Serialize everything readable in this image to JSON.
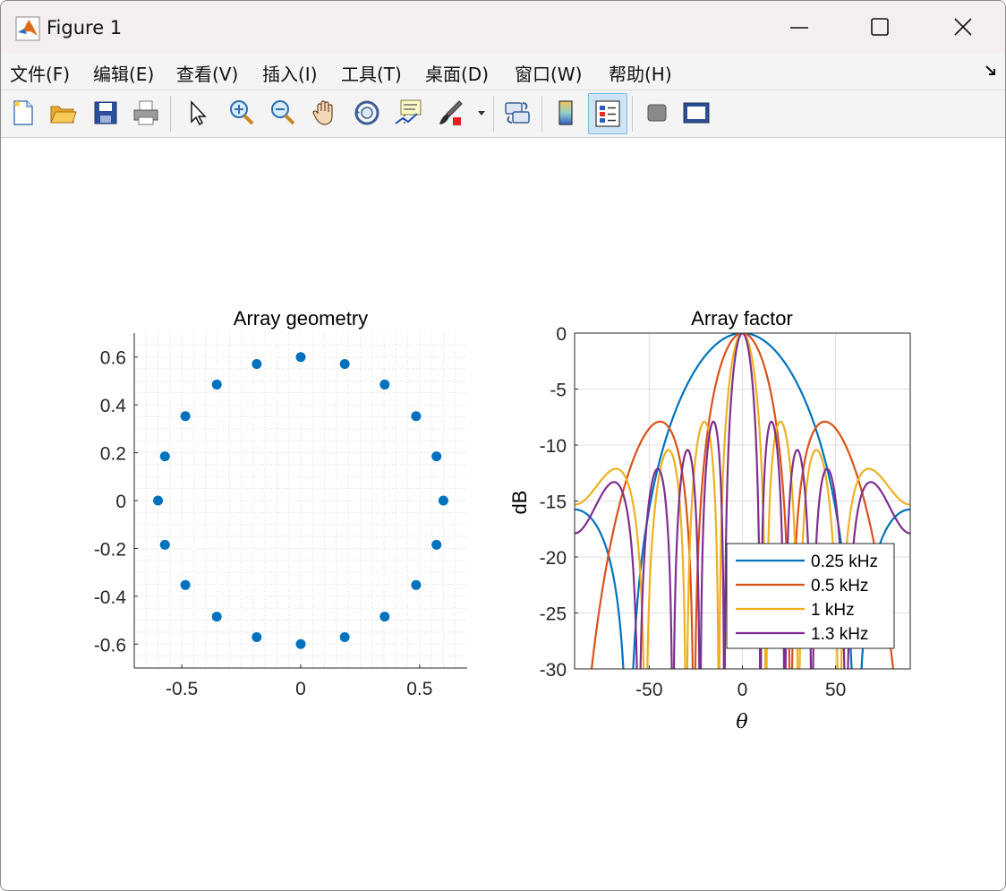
{
  "window": {
    "title": "Figure 1"
  },
  "menu": {
    "items": [
      {
        "label": "文件(F)"
      },
      {
        "label": "编辑(E)"
      },
      {
        "label": "查看(V)"
      },
      {
        "label": "插入(I)"
      },
      {
        "label": "工具(T)"
      },
      {
        "label": "桌面(D)"
      },
      {
        "label": "窗口(W)"
      },
      {
        "label": "帮助(H)"
      }
    ]
  },
  "toolbar": {
    "icons": [
      "new-figure-icon",
      "open-file-icon",
      "save-icon",
      "print-icon",
      "select-arrow-icon",
      "zoom-in-icon",
      "zoom-out-icon",
      "pan-hand-icon",
      "rotate-3d-icon",
      "data-cursor-icon",
      "brush-icon",
      "link-plot-icon",
      "colorbar-icon",
      "legend-icon",
      "hide-plot-tools-icon",
      "show-plot-tools-icon"
    ],
    "legend_toggle_active": true
  },
  "chart_data": [
    {
      "type": "scatter",
      "title": "Array geometry",
      "xlabel": "",
      "ylabel": "",
      "xlim": [
        -0.7,
        0.7
      ],
      "ylim": [
        -0.7,
        0.7
      ],
      "xticks": [
        "-0.5",
        "0",
        "0.5"
      ],
      "yticks": [
        "0.6",
        "0.4",
        "0.2",
        "0",
        "-0.2",
        "-0.4",
        "-0.6"
      ],
      "grid": "minor",
      "marker_color": "#0072BD",
      "points": [
        {
          "x": 0.6,
          "y": 0.0
        },
        {
          "x": 0.571,
          "y": 0.185
        },
        {
          "x": 0.485,
          "y": 0.353
        },
        {
          "x": 0.353,
          "y": 0.485
        },
        {
          "x": 0.185,
          "y": 0.571
        },
        {
          "x": 0.0,
          "y": 0.6
        },
        {
          "x": -0.185,
          "y": 0.571
        },
        {
          "x": -0.353,
          "y": 0.485
        },
        {
          "x": -0.485,
          "y": 0.353
        },
        {
          "x": -0.571,
          "y": 0.185
        },
        {
          "x": -0.6,
          "y": 0.0
        },
        {
          "x": -0.571,
          "y": -0.185
        },
        {
          "x": -0.485,
          "y": -0.353
        },
        {
          "x": -0.353,
          "y": -0.485
        },
        {
          "x": -0.185,
          "y": -0.571
        },
        {
          "x": 0.0,
          "y": -0.6
        },
        {
          "x": 0.185,
          "y": -0.571
        },
        {
          "x": 0.353,
          "y": -0.485
        },
        {
          "x": 0.485,
          "y": -0.353
        },
        {
          "x": 0.571,
          "y": -0.185
        }
      ]
    },
    {
      "type": "line",
      "title": "Array factor",
      "xlabel": "θ",
      "ylabel": "dB",
      "xlim": [
        -90,
        90
      ],
      "ylim": [
        -30,
        0
      ],
      "xticks": [
        "-50",
        "0",
        "50"
      ],
      "yticks": [
        "0",
        "-5",
        "-10",
        "-15",
        "-20",
        "-25",
        "-30"
      ],
      "grid": "major",
      "legend": "bottom-right",
      "series": [
        {
          "name": "0.25 kHz",
          "color": "#0072BD",
          "freq_hz": 250
        },
        {
          "name": "0.5 kHz",
          "color": "#D95319",
          "freq_hz": 500
        },
        {
          "name": "1 kHz",
          "color": "#EDB120",
          "freq_hz": 1000
        },
        {
          "name": "1.3 kHz",
          "color": "#7E2F8E",
          "freq_hz": 1300
        }
      ]
    }
  ]
}
